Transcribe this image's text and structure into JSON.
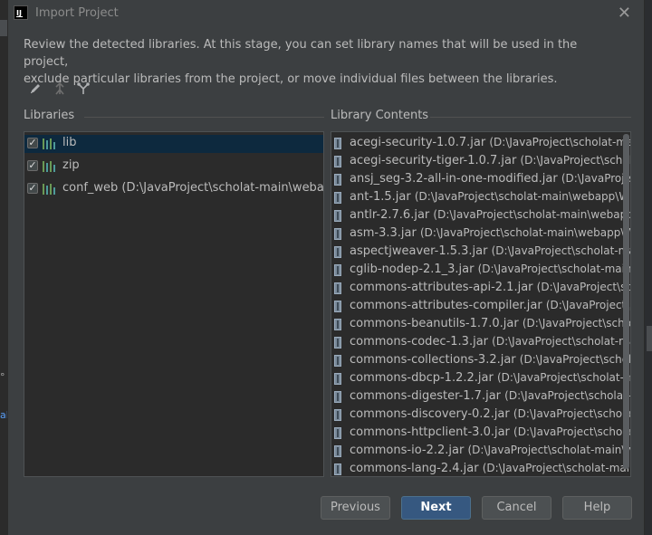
{
  "window": {
    "title": "Import Project",
    "app_icon_text": "IJ",
    "close_icon": "close-icon"
  },
  "description": {
    "line1": "Review the detected libraries. At this stage, you can set library names that will be used in the project,",
    "line2": "exclude particular libraries from the project, or move individual files between the libraries."
  },
  "toolbar": {
    "icons": [
      "edit-icon",
      "merge-icon",
      "split-icon"
    ]
  },
  "libraries": {
    "header": "Libraries",
    "items": [
      {
        "label": "lib",
        "checked": true,
        "selected": true
      },
      {
        "label": "zip",
        "checked": true,
        "selected": false
      },
      {
        "label": "conf_web (D:\\JavaProject\\scholat-main\\webapp\\co",
        "checked": true,
        "selected": false
      }
    ]
  },
  "contents": {
    "header": "Library Contents",
    "items": [
      {
        "name": "acegi-security-1.0.7.jar",
        "path": "(D:\\JavaProject\\scholat-main\\w"
      },
      {
        "name": "acegi-security-tiger-1.0.7.jar",
        "path": "(D:\\JavaProject\\scholat-r"
      },
      {
        "name": "ansj_seg-3.2-all-in-one-modified.jar",
        "path": "(D:\\JavaProject\\s"
      },
      {
        "name": "ant-1.5.jar",
        "path": "(D:\\JavaProject\\scholat-main\\webapp\\WEB"
      },
      {
        "name": "antlr-2.7.6.jar",
        "path": "(D:\\JavaProject\\scholat-main\\webapp\\"
      },
      {
        "name": "asm-3.3.jar",
        "path": "(D:\\JavaProject\\scholat-main\\webapp\\WE"
      },
      {
        "name": "aspectjweaver-1.5.3.jar",
        "path": "(D:\\JavaProject\\scholat-main\\"
      },
      {
        "name": "cglib-nodep-2.1_3.jar",
        "path": "(D:\\JavaProject\\scholat-main\\we"
      },
      {
        "name": "commons-attributes-api-2.1.jar",
        "path": "(D:\\JavaProject\\schola"
      },
      {
        "name": "commons-attributes-compiler.jar",
        "path": "(D:\\JavaProject\\scho"
      },
      {
        "name": "commons-beanutils-1.7.0.jar",
        "path": "(D:\\JavaProject\\scholat-r"
      },
      {
        "name": "commons-codec-1.3.jar",
        "path": "(D:\\JavaProject\\scholat-main\\"
      },
      {
        "name": "commons-collections-3.2.jar",
        "path": "(D:\\JavaProject\\scholat-r"
      },
      {
        "name": "commons-dbcp-1.2.2.jar",
        "path": "(D:\\JavaProject\\scholat-main"
      },
      {
        "name": "commons-digester-1.7.jar",
        "path": "(D:\\JavaProject\\scholat-ma"
      },
      {
        "name": "commons-discovery-0.2.jar",
        "path": "(D:\\JavaProject\\scholat-m"
      },
      {
        "name": "commons-httpclient-3.0.jar",
        "path": "(D:\\JavaProject\\scholat-m"
      },
      {
        "name": "commons-io-2.2.jar",
        "path": "(D:\\JavaProject\\scholat-main\\web"
      },
      {
        "name": "commons-lang-2.4.jar",
        "path": "(D:\\JavaProject\\scholat-main\\we"
      }
    ]
  },
  "buttons": {
    "previous": "Previous",
    "next": "Next",
    "cancel": "Cancel",
    "help": "Help"
  },
  "colors": {
    "dialog_bg": "#3c3f41",
    "panel_bg": "#2b2b2b",
    "selection": "#0d293e",
    "primary_button": "#365880"
  }
}
